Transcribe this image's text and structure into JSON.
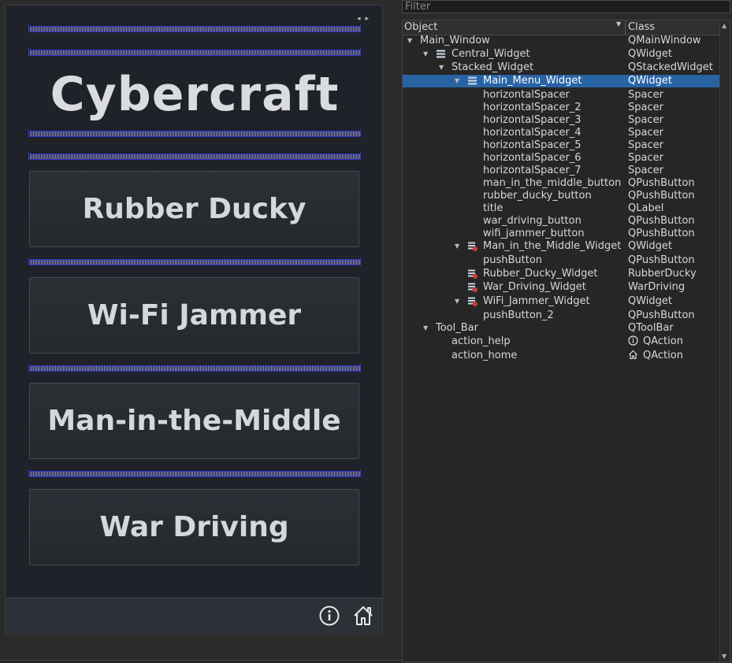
{
  "form": {
    "title": "Cybercraft",
    "buttons": [
      "Rubber Ducky",
      "Wi-Fi Jammer",
      "Man-in-the-Middle",
      "War Driving"
    ],
    "toolbar_icons": [
      "info-icon",
      "home-icon"
    ]
  },
  "inspector": {
    "filter_placeholder": "Filter",
    "headers": {
      "object": "Object",
      "class": "Class"
    },
    "rows": [
      {
        "object": "Main_Window",
        "class": "QMainWindow",
        "depth": 0,
        "expand": "open",
        "icon": ""
      },
      {
        "object": "Central_Widget",
        "class": "QWidget",
        "depth": 1,
        "expand": "open",
        "icon": "layout-icon"
      },
      {
        "object": "Stacked_Widget",
        "class": "QStackedWidget",
        "depth": 2,
        "expand": "open",
        "icon": ""
      },
      {
        "object": "Main_Menu_Widget",
        "class": "QWidget",
        "depth": 3,
        "expand": "open",
        "icon": "layout-icon",
        "selected": true
      },
      {
        "object": "horizontalSpacer",
        "class": "Spacer",
        "depth": 4,
        "expand": "",
        "icon": ""
      },
      {
        "object": "horizontalSpacer_2",
        "class": "Spacer",
        "depth": 4,
        "expand": "",
        "icon": ""
      },
      {
        "object": "horizontalSpacer_3",
        "class": "Spacer",
        "depth": 4,
        "expand": "",
        "icon": ""
      },
      {
        "object": "horizontalSpacer_4",
        "class": "Spacer",
        "depth": 4,
        "expand": "",
        "icon": ""
      },
      {
        "object": "horizontalSpacer_5",
        "class": "Spacer",
        "depth": 4,
        "expand": "",
        "icon": ""
      },
      {
        "object": "horizontalSpacer_6",
        "class": "Spacer",
        "depth": 4,
        "expand": "",
        "icon": ""
      },
      {
        "object": "horizontalSpacer_7",
        "class": "Spacer",
        "depth": 4,
        "expand": "",
        "icon": ""
      },
      {
        "object": "man_in_the_middle_button",
        "class": "QPushButton",
        "depth": 4,
        "expand": "",
        "icon": ""
      },
      {
        "object": "rubber_ducky_button",
        "class": "QPushButton",
        "depth": 4,
        "expand": "",
        "icon": ""
      },
      {
        "object": "title",
        "class": "QLabel",
        "depth": 4,
        "expand": "",
        "icon": ""
      },
      {
        "object": "war_driving_button",
        "class": "QPushButton",
        "depth": 4,
        "expand": "",
        "icon": ""
      },
      {
        "object": "wifi_jammer_button",
        "class": "QPushButton",
        "depth": 4,
        "expand": "",
        "icon": ""
      },
      {
        "object": "Man_in_the_Middle_Widget",
        "class": "QWidget",
        "depth": 3,
        "expand": "open",
        "icon": "broken-layout-icon"
      },
      {
        "object": "pushButton",
        "class": "QPushButton",
        "depth": 4,
        "expand": "",
        "icon": ""
      },
      {
        "object": "Rubber_Ducky_Widget",
        "class": "RubberDucky",
        "depth": 3,
        "expand": "",
        "icon": "broken-layout-icon"
      },
      {
        "object": "War_Driving_Widget",
        "class": "WarDriving",
        "depth": 3,
        "expand": "",
        "icon": "broken-layout-icon"
      },
      {
        "object": "WiFi_Jammer_Widget",
        "class": "QWidget",
        "depth": 3,
        "expand": "open",
        "icon": "broken-layout-icon"
      },
      {
        "object": "pushButton_2",
        "class": "QPushButton",
        "depth": 4,
        "expand": "",
        "icon": ""
      },
      {
        "object": "Tool_Bar",
        "class": "QToolBar",
        "depth": 1,
        "expand": "open",
        "icon": ""
      },
      {
        "object": "action_help",
        "class": "QAction",
        "depth": 2,
        "expand": "",
        "icon": "",
        "class_icon": "info-icon"
      },
      {
        "object": "action_home",
        "class": "QAction",
        "depth": 2,
        "expand": "",
        "icon": "",
        "class_icon": "home-icon"
      }
    ]
  },
  "colors": {
    "selection": "#2864a4",
    "spacer": "#2b34c8",
    "form_bg": "#1f2228"
  }
}
